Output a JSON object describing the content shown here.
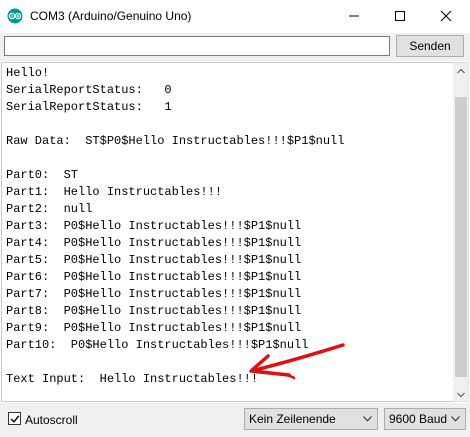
{
  "window": {
    "title": "COM3 (Arduino/Genuino Uno)",
    "controls": {
      "minimize": "minimize",
      "maximize": "maximize",
      "close": "close"
    }
  },
  "send_bar": {
    "input_value": "",
    "button_label": "Senden"
  },
  "serial_output": {
    "lines": [
      "Hello!",
      "SerialReportStatus:   0",
      "SerialReportStatus:   1",
      "",
      "Raw Data:  ST$P0$Hello Instructables!!!$P1$null",
      "",
      "Part0:  ST",
      "Part1:  Hello Instructables!!!",
      "Part2:  null",
      "Part3:  P0$Hello Instructables!!!$P1$null",
      "Part4:  P0$Hello Instructables!!!$P1$null",
      "Part5:  P0$Hello Instructables!!!$P1$null",
      "Part6:  P0$Hello Instructables!!!$P1$null",
      "Part7:  P0$Hello Instructables!!!$P1$null",
      "Part8:  P0$Hello Instructables!!!$P1$null",
      "Part9:  P0$Hello Instructables!!!$P1$null",
      "Part10:  P0$Hello Instructables!!!$P1$null",
      "",
      "Text Input:  Hello Instructables!!!"
    ]
  },
  "footer": {
    "autoscroll_label": "Autoscroll",
    "autoscroll_checked": true,
    "line_ending": "Kein Zeilenende",
    "baud_rate": "9600 Baud"
  },
  "colors": {
    "annotation_arrow": "#e01010",
    "arduino_icon": "#00979c"
  }
}
